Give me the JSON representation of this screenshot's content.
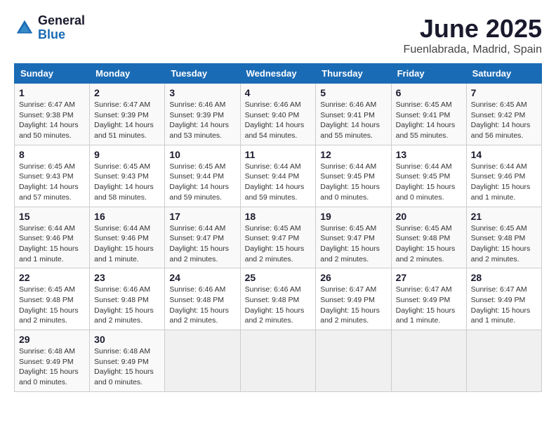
{
  "header": {
    "logo_general": "General",
    "logo_blue": "Blue",
    "title": "June 2025",
    "subtitle": "Fuenlabrada, Madrid, Spain"
  },
  "calendar": {
    "days_of_week": [
      "Sunday",
      "Monday",
      "Tuesday",
      "Wednesday",
      "Thursday",
      "Friday",
      "Saturday"
    ],
    "weeks": [
      [
        {
          "day": "1",
          "text": "Sunrise: 6:47 AM\nSunset: 9:38 PM\nDaylight: 14 hours\nand 50 minutes."
        },
        {
          "day": "2",
          "text": "Sunrise: 6:47 AM\nSunset: 9:39 PM\nDaylight: 14 hours\nand 51 minutes."
        },
        {
          "day": "3",
          "text": "Sunrise: 6:46 AM\nSunset: 9:39 PM\nDaylight: 14 hours\nand 53 minutes."
        },
        {
          "day": "4",
          "text": "Sunrise: 6:46 AM\nSunset: 9:40 PM\nDaylight: 14 hours\nand 54 minutes."
        },
        {
          "day": "5",
          "text": "Sunrise: 6:46 AM\nSunset: 9:41 PM\nDaylight: 14 hours\nand 55 minutes."
        },
        {
          "day": "6",
          "text": "Sunrise: 6:45 AM\nSunset: 9:41 PM\nDaylight: 14 hours\nand 55 minutes."
        },
        {
          "day": "7",
          "text": "Sunrise: 6:45 AM\nSunset: 9:42 PM\nDaylight: 14 hours\nand 56 minutes."
        }
      ],
      [
        {
          "day": "8",
          "text": "Sunrise: 6:45 AM\nSunset: 9:43 PM\nDaylight: 14 hours\nand 57 minutes."
        },
        {
          "day": "9",
          "text": "Sunrise: 6:45 AM\nSunset: 9:43 PM\nDaylight: 14 hours\nand 58 minutes."
        },
        {
          "day": "10",
          "text": "Sunrise: 6:45 AM\nSunset: 9:44 PM\nDaylight: 14 hours\nand 59 minutes."
        },
        {
          "day": "11",
          "text": "Sunrise: 6:44 AM\nSunset: 9:44 PM\nDaylight: 14 hours\nand 59 minutes."
        },
        {
          "day": "12",
          "text": "Sunrise: 6:44 AM\nSunset: 9:45 PM\nDaylight: 15 hours\nand 0 minutes."
        },
        {
          "day": "13",
          "text": "Sunrise: 6:44 AM\nSunset: 9:45 PM\nDaylight: 15 hours\nand 0 minutes."
        },
        {
          "day": "14",
          "text": "Sunrise: 6:44 AM\nSunset: 9:46 PM\nDaylight: 15 hours\nand 1 minute."
        }
      ],
      [
        {
          "day": "15",
          "text": "Sunrise: 6:44 AM\nSunset: 9:46 PM\nDaylight: 15 hours\nand 1 minute."
        },
        {
          "day": "16",
          "text": "Sunrise: 6:44 AM\nSunset: 9:46 PM\nDaylight: 15 hours\nand 1 minute."
        },
        {
          "day": "17",
          "text": "Sunrise: 6:44 AM\nSunset: 9:47 PM\nDaylight: 15 hours\nand 2 minutes."
        },
        {
          "day": "18",
          "text": "Sunrise: 6:45 AM\nSunset: 9:47 PM\nDaylight: 15 hours\nand 2 minutes."
        },
        {
          "day": "19",
          "text": "Sunrise: 6:45 AM\nSunset: 9:47 PM\nDaylight: 15 hours\nand 2 minutes."
        },
        {
          "day": "20",
          "text": "Sunrise: 6:45 AM\nSunset: 9:48 PM\nDaylight: 15 hours\nand 2 minutes."
        },
        {
          "day": "21",
          "text": "Sunrise: 6:45 AM\nSunset: 9:48 PM\nDaylight: 15 hours\nand 2 minutes."
        }
      ],
      [
        {
          "day": "22",
          "text": "Sunrise: 6:45 AM\nSunset: 9:48 PM\nDaylight: 15 hours\nand 2 minutes."
        },
        {
          "day": "23",
          "text": "Sunrise: 6:46 AM\nSunset: 9:48 PM\nDaylight: 15 hours\nand 2 minutes."
        },
        {
          "day": "24",
          "text": "Sunrise: 6:46 AM\nSunset: 9:48 PM\nDaylight: 15 hours\nand 2 minutes."
        },
        {
          "day": "25",
          "text": "Sunrise: 6:46 AM\nSunset: 9:48 PM\nDaylight: 15 hours\nand 2 minutes."
        },
        {
          "day": "26",
          "text": "Sunrise: 6:47 AM\nSunset: 9:49 PM\nDaylight: 15 hours\nand 2 minutes."
        },
        {
          "day": "27",
          "text": "Sunrise: 6:47 AM\nSunset: 9:49 PM\nDaylight: 15 hours\nand 1 minute."
        },
        {
          "day": "28",
          "text": "Sunrise: 6:47 AM\nSunset: 9:49 PM\nDaylight: 15 hours\nand 1 minute."
        }
      ],
      [
        {
          "day": "29",
          "text": "Sunrise: 6:48 AM\nSunset: 9:49 PM\nDaylight: 15 hours\nand 0 minutes."
        },
        {
          "day": "30",
          "text": "Sunrise: 6:48 AM\nSunset: 9:49 PM\nDaylight: 15 hours\nand 0 minutes."
        },
        {
          "day": "",
          "text": ""
        },
        {
          "day": "",
          "text": ""
        },
        {
          "day": "",
          "text": ""
        },
        {
          "day": "",
          "text": ""
        },
        {
          "day": "",
          "text": ""
        }
      ]
    ]
  }
}
